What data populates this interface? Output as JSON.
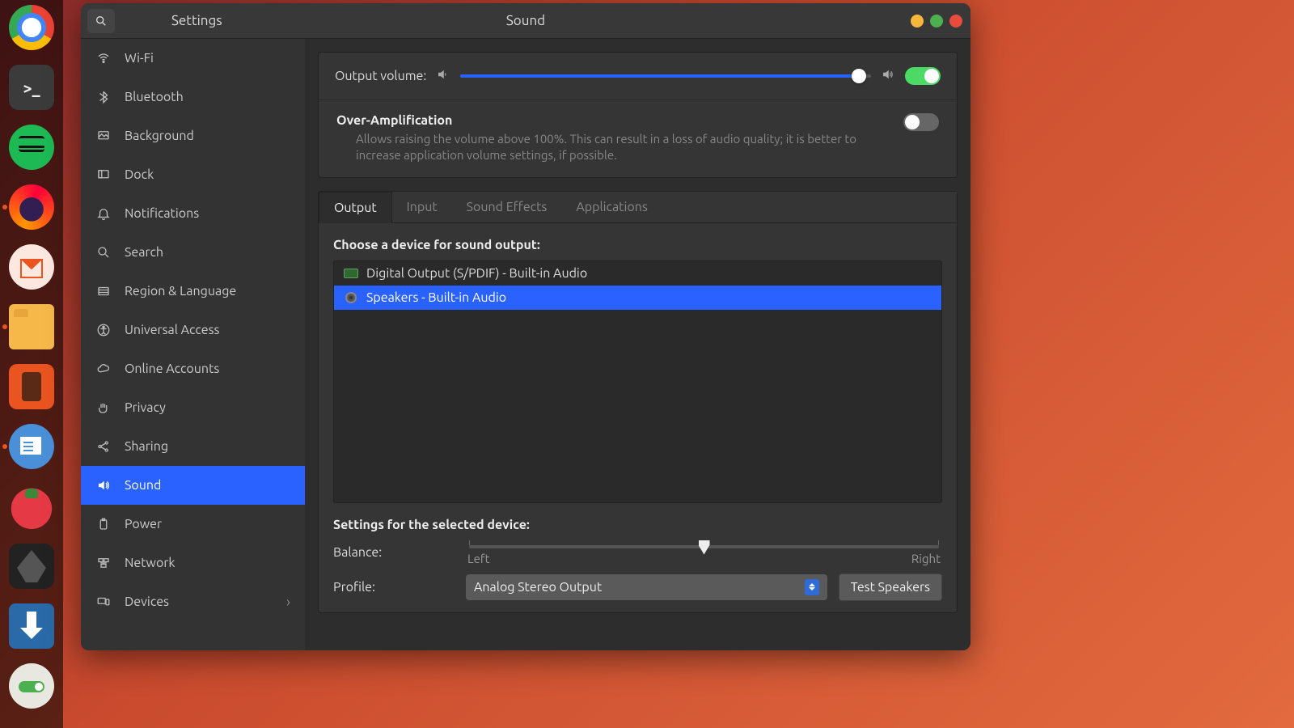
{
  "window": {
    "app_title": "Settings",
    "page_title": "Sound"
  },
  "sidebar": {
    "items": [
      {
        "label": "Wi-Fi"
      },
      {
        "label": "Bluetooth"
      },
      {
        "label": "Background"
      },
      {
        "label": "Dock"
      },
      {
        "label": "Notifications"
      },
      {
        "label": "Search"
      },
      {
        "label": "Region & Language"
      },
      {
        "label": "Universal Access"
      },
      {
        "label": "Online Accounts"
      },
      {
        "label": "Privacy"
      },
      {
        "label": "Sharing"
      },
      {
        "label": "Sound"
      },
      {
        "label": "Power"
      },
      {
        "label": "Network"
      },
      {
        "label": "Devices"
      }
    ],
    "active_index": 11,
    "has_chevron_index": 14
  },
  "output_volume": {
    "label": "Output volume:",
    "percent": 97,
    "mute_toggle_on": true
  },
  "over_amp": {
    "title": "Over-Amplification",
    "description": "Allows raising the volume above 100%. This can result in a loss of audio quality; it is better to increase application volume settings, if possible.",
    "enabled": false
  },
  "tabs": {
    "items": [
      "Output",
      "Input",
      "Sound Effects",
      "Applications"
    ],
    "active_index": 0
  },
  "output": {
    "choose_label": "Choose a device for sound output:",
    "devices": [
      {
        "label": "Digital Output (S/PDIF) - Built-in Audio",
        "icon": "card"
      },
      {
        "label": "Speakers - Built-in Audio",
        "icon": "speaker"
      }
    ],
    "selected_index": 1,
    "settings_label": "Settings for the selected device:",
    "balance": {
      "label": "Balance:",
      "left_label": "Left",
      "right_label": "Right",
      "value_percent": 50
    },
    "profile": {
      "label": "Profile:",
      "selected": "Analog Stereo Output"
    },
    "test_button": "Test Speakers"
  },
  "dock": {
    "running_indices": [
      3,
      5,
      7
    ]
  }
}
